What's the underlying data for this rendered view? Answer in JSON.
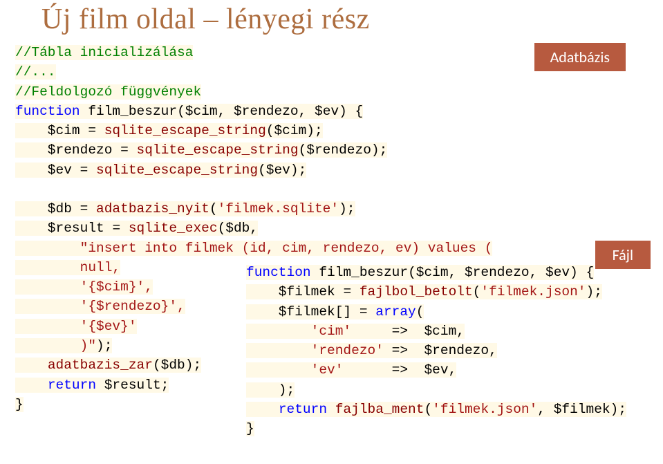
{
  "title": "Új film oldal – lényegi rész",
  "labels": {
    "database": "Adatbázis",
    "file": "Fájl"
  },
  "code1": {
    "c1": "//Tábla inicializálása",
    "c2": "//...",
    "c3": "//Feldolgozó függvények",
    "kw_function": "function",
    "fn_name": "film_beszur",
    "sig_open": "(",
    "p1": "$cim",
    "p2": "$rendezo",
    "p3": "$ev",
    "sig_close_brace": ") {",
    "l1_lhs": "    $cim ",
    "eq": "= ",
    "esc": "sqlite_escape_string",
    "l1_arg": "($cim);",
    "l2_lhs": "    $rendezo ",
    "l2_arg": "($rendezo);",
    "l3_lhs": "    $ev ",
    "l3_arg": "($ev);",
    "blank": "",
    "l4_lhs": "    $db ",
    "nyit": "adatbazis_nyit",
    "l4_arg_open": "(",
    "l4_str": "'filmek.sqlite'",
    "l4_close": ");",
    "l5_lhs": "    $result ",
    "exec": "sqlite_exec",
    "l5_arg_open": "($db,",
    "sql1": "        \"insert into filmek (id, cim, rendezo, ev) values (",
    "sql2": "        null,",
    "sql3": "        '{$cim}',",
    "sql4": "        '{$rendezo}',",
    "sql5": "        '{$ev}'",
    "sql6": "        )\"",
    "sql6b": ");",
    "zar": "adatbazis_zar",
    "l6_pre": "    ",
    "l6_arg": "($db);",
    "kw_return": "return",
    "l7_pre": "    ",
    "l7_val": " $result;",
    "close_brace": "}"
  },
  "code2": {
    "kw_function": "function",
    "fn_name": "film_beszur",
    "sig_open": "(",
    "p1": "$cim",
    "p2": "$rendezo",
    "p3": "$ev",
    "sig_close_brace": ") {",
    "l1_lhs": "    $filmek ",
    "eq": "= ",
    "betolt": "fajlbol_betolt",
    "l1_open": "(",
    "l1_str": "'filmek.json'",
    "l1_close": ");",
    "l2_lhs": "    $filmek[] ",
    "kw_array": "array",
    "l2_open": "(",
    "k1": "'cim'",
    "arrow": "=>",
    "v1": "$cim",
    "k2": "'rendezo'",
    "v2": "$rendezo",
    "k3": "'ev'",
    "v3": "$ev",
    "arr_close": "    );",
    "kw_return": "return",
    "ment": "fajlba_ment",
    "ret_open": "(",
    "ret_str": "'filmek.json'",
    "ret_mid": ", $filmek);",
    "pre4": "    ",
    "close_brace": "}"
  }
}
